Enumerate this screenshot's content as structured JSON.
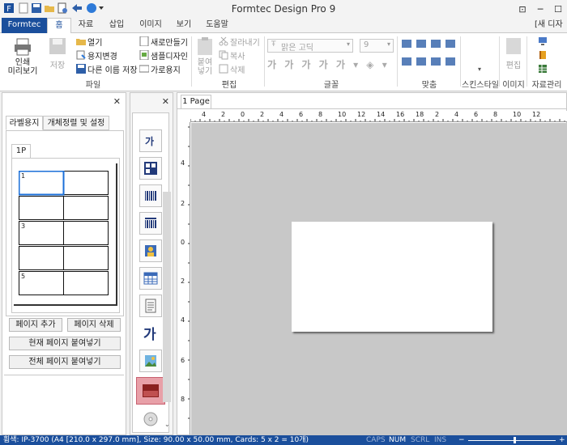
{
  "window": {
    "title": "Formtec Design Pro 9"
  },
  "tabs": [
    {
      "label": "Formtec"
    },
    {
      "label": "홈"
    },
    {
      "label": "자료"
    },
    {
      "label": "삽입"
    },
    {
      "label": "이미지"
    },
    {
      "label": "보기"
    },
    {
      "label": "도움말"
    }
  ],
  "tabbar_right": "[새 디자",
  "ribbon": {
    "print_preview": "인쇄\n미리보기",
    "save": "저장",
    "open": "열기",
    "change_paper": "용지변경",
    "save_as": "다른 이름 저장",
    "new_create": "새로만들기",
    "sample_design": "샘플디자인",
    "landscape": "가로용지",
    "file_group": "파일",
    "paste": "붙여\n넣기",
    "cut": "잘라내기",
    "copy": "복사",
    "delete": "삭제",
    "edit_group": "편집",
    "font_name": "맑은 고딕",
    "font_size": "9",
    "font_group": "글꼴",
    "align_group": "맞춤",
    "skin_style": "스킨스타일",
    "image_edit": "편집",
    "image_group": "이미지",
    "data_manage": "자료관리"
  },
  "left_panel": {
    "tab_label_paper": "라벨용지",
    "tab_sort": "개체정렬 및 설정",
    "page_tab": "1P",
    "cell_numbers": [
      "1",
      "3",
      "5"
    ],
    "add_page": "페이지 추가",
    "delete_page": "페이지 삭제",
    "paste_current": "현재 페이지 붙여넣기",
    "paste_all": "전체 페이지 붙여넣기"
  },
  "doc": {
    "tab": "1 Page",
    "ruler_top": [
      "4",
      "2",
      "0",
      "2",
      "4",
      "6",
      "8",
      "10",
      "12",
      "14",
      "16",
      "18",
      "2",
      "4",
      "6",
      "8",
      "10",
      "12"
    ],
    "ruler_left": [
      "4",
      "2",
      "0",
      "2",
      "4",
      "6",
      "8"
    ]
  },
  "status": {
    "text": "휨색: IP-3700 (A4 [210.0 x 297.0 mm], Size: 90.00 x 50.00 mm,  Cards: 5 x 2 = 10개)",
    "caps": "CAPS",
    "num": "NUM",
    "scrl": "SCRL",
    "ins": "INS"
  },
  "colors": {
    "accent": "#1b4f9c",
    "highlight_tool": "#e8a0a8"
  }
}
